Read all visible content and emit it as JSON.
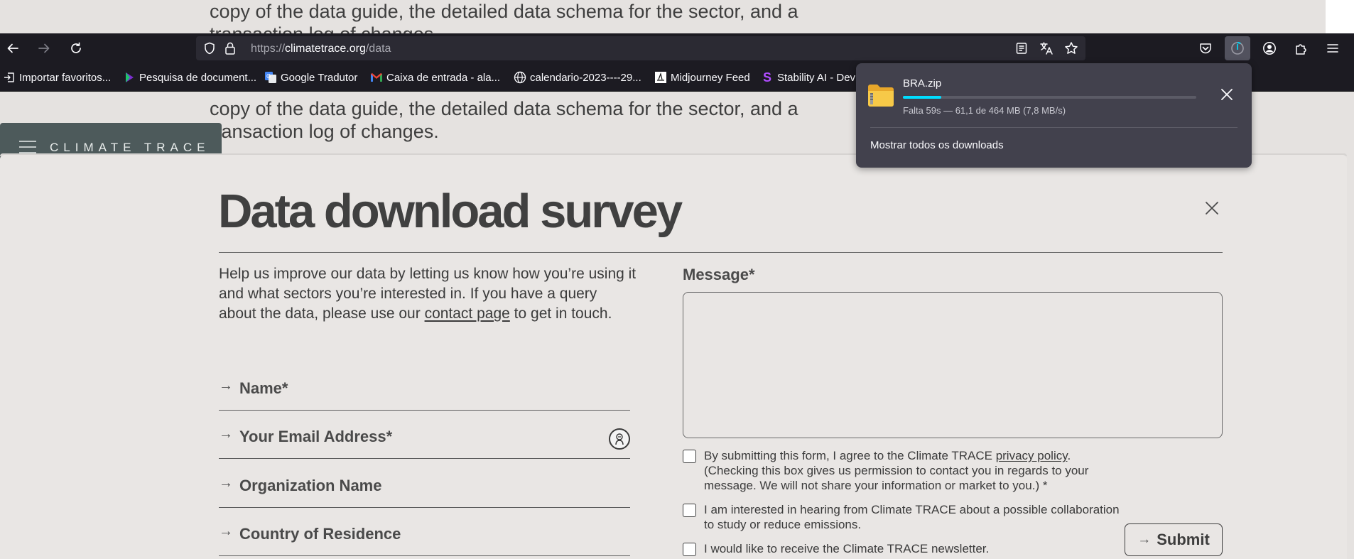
{
  "background_page": {
    "line1": "copy of the data guide, the detailed data schema for the sector, and a",
    "line2": "transaction log of changes.",
    "line3": "copy of the data guide, the detailed data schema for the sector, and a",
    "line4": "transaction log of changes."
  },
  "browser": {
    "url_prefix": "https://",
    "url_domain": "climatetrace.org",
    "url_path": "/data",
    "bookmarks": [
      {
        "label": "Importar favoritos...",
        "icon": "import-icon"
      },
      {
        "label": "Pesquisa de document...",
        "icon": "document-search-icon"
      },
      {
        "label": "Google Tradutor",
        "icon": "google-translate-icon"
      },
      {
        "label": "Caixa de entrada - ala...",
        "icon": "gmail-icon"
      },
      {
        "label": "calendario-2023----29...",
        "icon": "globe-icon"
      },
      {
        "label": "Midjourney Feed",
        "icon": "midjourney-icon"
      },
      {
        "label": "Stability AI - Dev",
        "icon": "stability-icon"
      }
    ],
    "colors": {
      "accent": "#00ddff",
      "toolbar": "#1c1b22"
    }
  },
  "downloads_panel": {
    "file_name": "BRA.zip",
    "status": "Falta 59s — 61,1 de 464 MB (7,8 MB/s)",
    "progress_fraction": 0.13,
    "show_all": "Mostrar todos os downloads"
  },
  "site": {
    "logo_text": "CLIMATE TRACE"
  },
  "survey": {
    "title": "Data download survey",
    "intro_before": "Help us improve our data by letting us know how you’re using it and what sectors you’re interested in. If you have a query about the data, please use our ",
    "intro_link": "contact page",
    "intro_after": " to get in touch.",
    "fields": [
      {
        "label": "Name*"
      },
      {
        "label": "Your Email Address*"
      },
      {
        "label": "Organization Name"
      },
      {
        "label": "Country of Residence"
      }
    ],
    "message_label": "Message*",
    "message_value": "",
    "checkbox1_before": "By submitting this form, I agree to the Climate TRACE ",
    "checkbox1_link": "privacy policy",
    "checkbox1_after": ".",
    "checkbox1_line2": "(Checking this box gives us permission to contact you in regards to your",
    "checkbox1_line3": "message. We will not share your information or market to you.) *",
    "checkbox2_line1": "I am interested in hearing from Climate TRACE about a possible collaboration",
    "checkbox2_line2": "to study or reduce emissions.",
    "checkbox3": "I would like to receive the Climate TRACE newsletter.",
    "submit_label": "Submit"
  }
}
